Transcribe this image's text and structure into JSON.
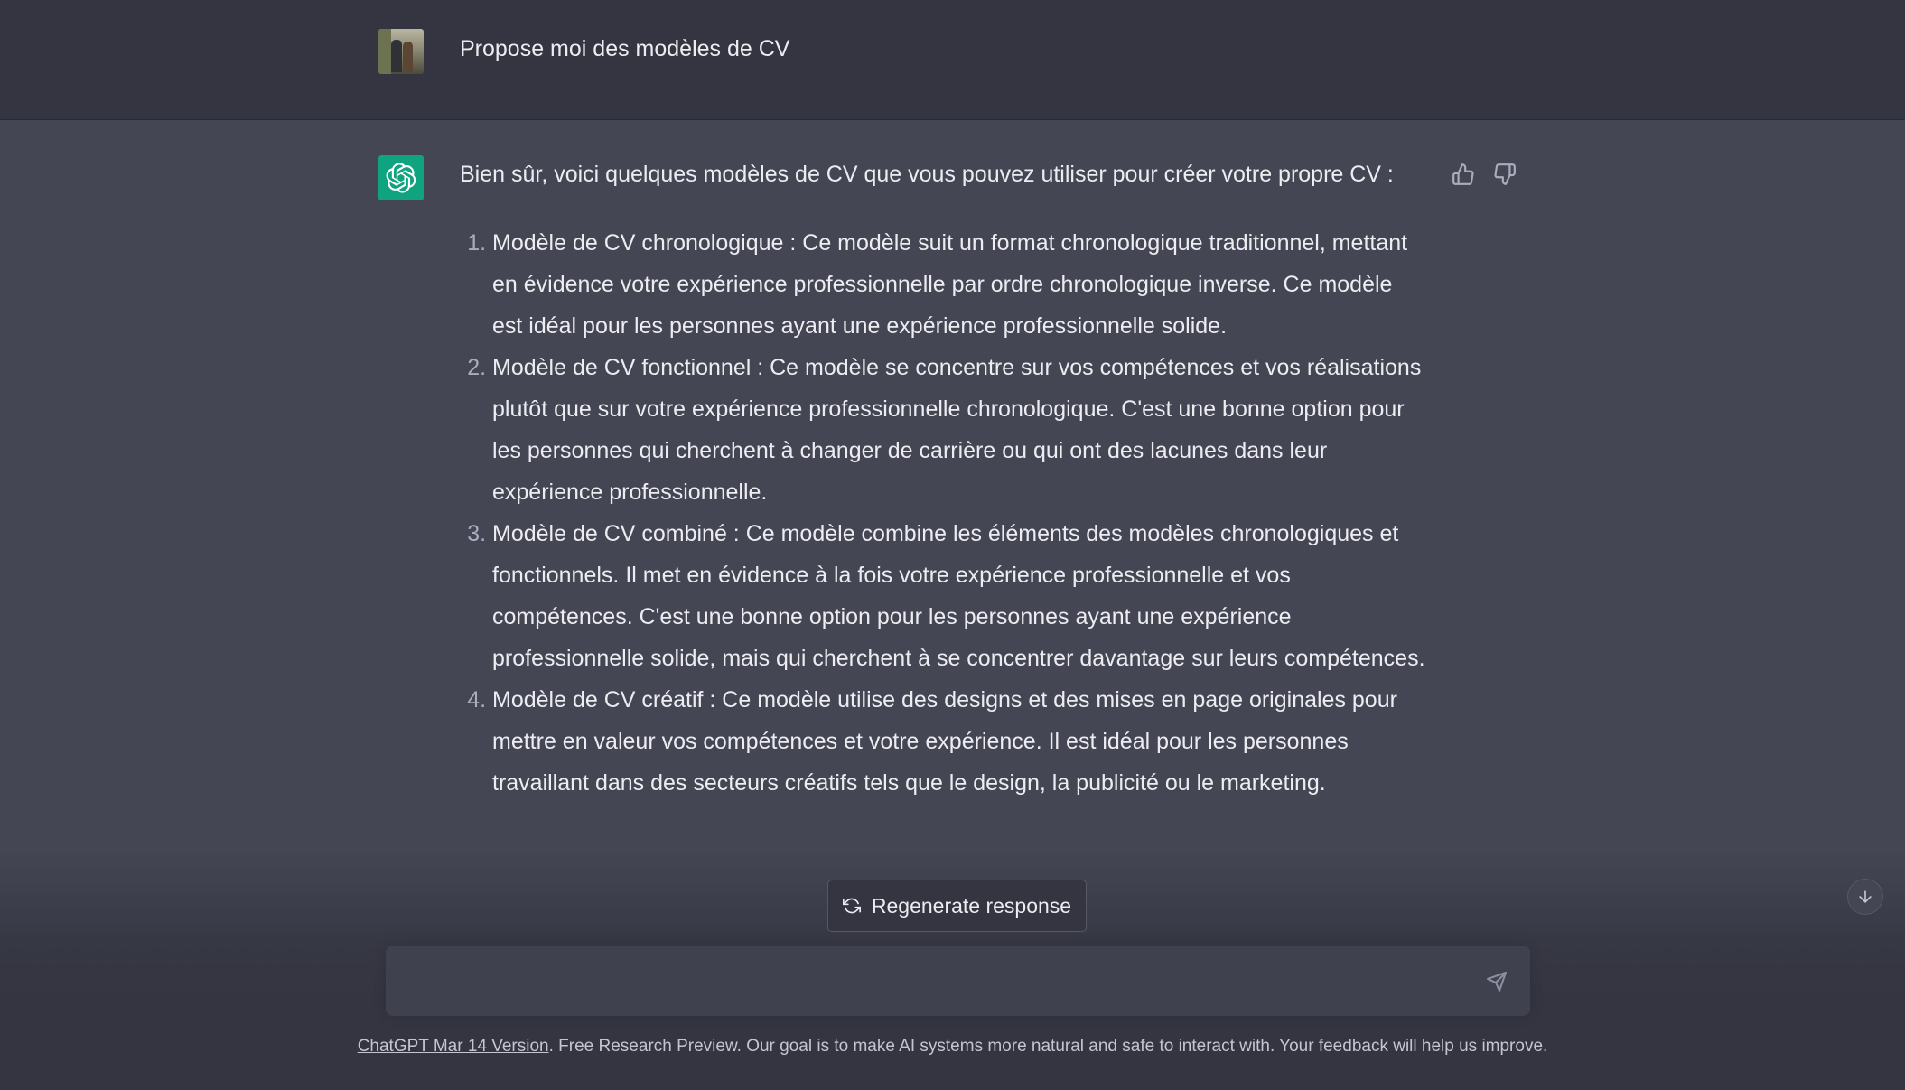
{
  "user_message": {
    "text": "Propose moi des modèles de CV"
  },
  "assistant_message": {
    "intro": "Bien sûr, voici quelques modèles de CV que vous pouvez utiliser pour créer votre propre CV :",
    "items": [
      "Modèle de CV chronologique : Ce modèle suit un format chronologique traditionnel, mettant en évidence votre expérience professionnelle par ordre chronologique inverse. Ce modèle est idéal pour les personnes ayant une expérience professionnelle solide.",
      "Modèle de CV fonctionnel : Ce modèle se concentre sur vos compétences et vos réalisations plutôt que sur votre expérience professionnelle chronologique. C'est une bonne option pour les personnes qui cherchent à changer de carrière ou qui ont des lacunes dans leur expérience professionnelle.",
      "Modèle de CV combiné : Ce modèle combine les éléments des modèles chronologiques et fonctionnels. Il met en évidence à la fois votre expérience professionnelle et vos compétences. C'est une bonne option pour les personnes ayant une expérience professionnelle solide, mais qui cherchent à se concentrer davantage sur leurs compétences.",
      "Modèle de CV créatif : Ce modèle utilise des designs et des mises en page originales pour mettre en valeur vos compétences et votre expérience. Il est idéal pour les personnes travaillant dans des secteurs créatifs tels que le design, la publicité ou le marketing."
    ]
  },
  "controls": {
    "regenerate_label": "Regenerate response",
    "input_placeholder": ""
  },
  "footer": {
    "version_link": "ChatGPT Mar 14 Version",
    "text": ". Free Research Preview. Our goal is to make AI systems more natural and safe to interact with. Your feedback will help us improve."
  },
  "icons": {
    "user_avatar": "user-photo-avatar",
    "assistant_avatar": "openai-logo-icon",
    "thumbs_up": "thumbs-up-icon",
    "thumbs_down": "thumbs-down-icon",
    "regenerate": "refresh-icon",
    "send": "send-icon",
    "scroll_down": "arrow-down-icon"
  },
  "colors": {
    "user_row_bg": "#343541",
    "assistant_row_bg": "#444654",
    "input_bg": "#40414f",
    "brand_green": "#10a37f",
    "text": "#ececf1"
  }
}
